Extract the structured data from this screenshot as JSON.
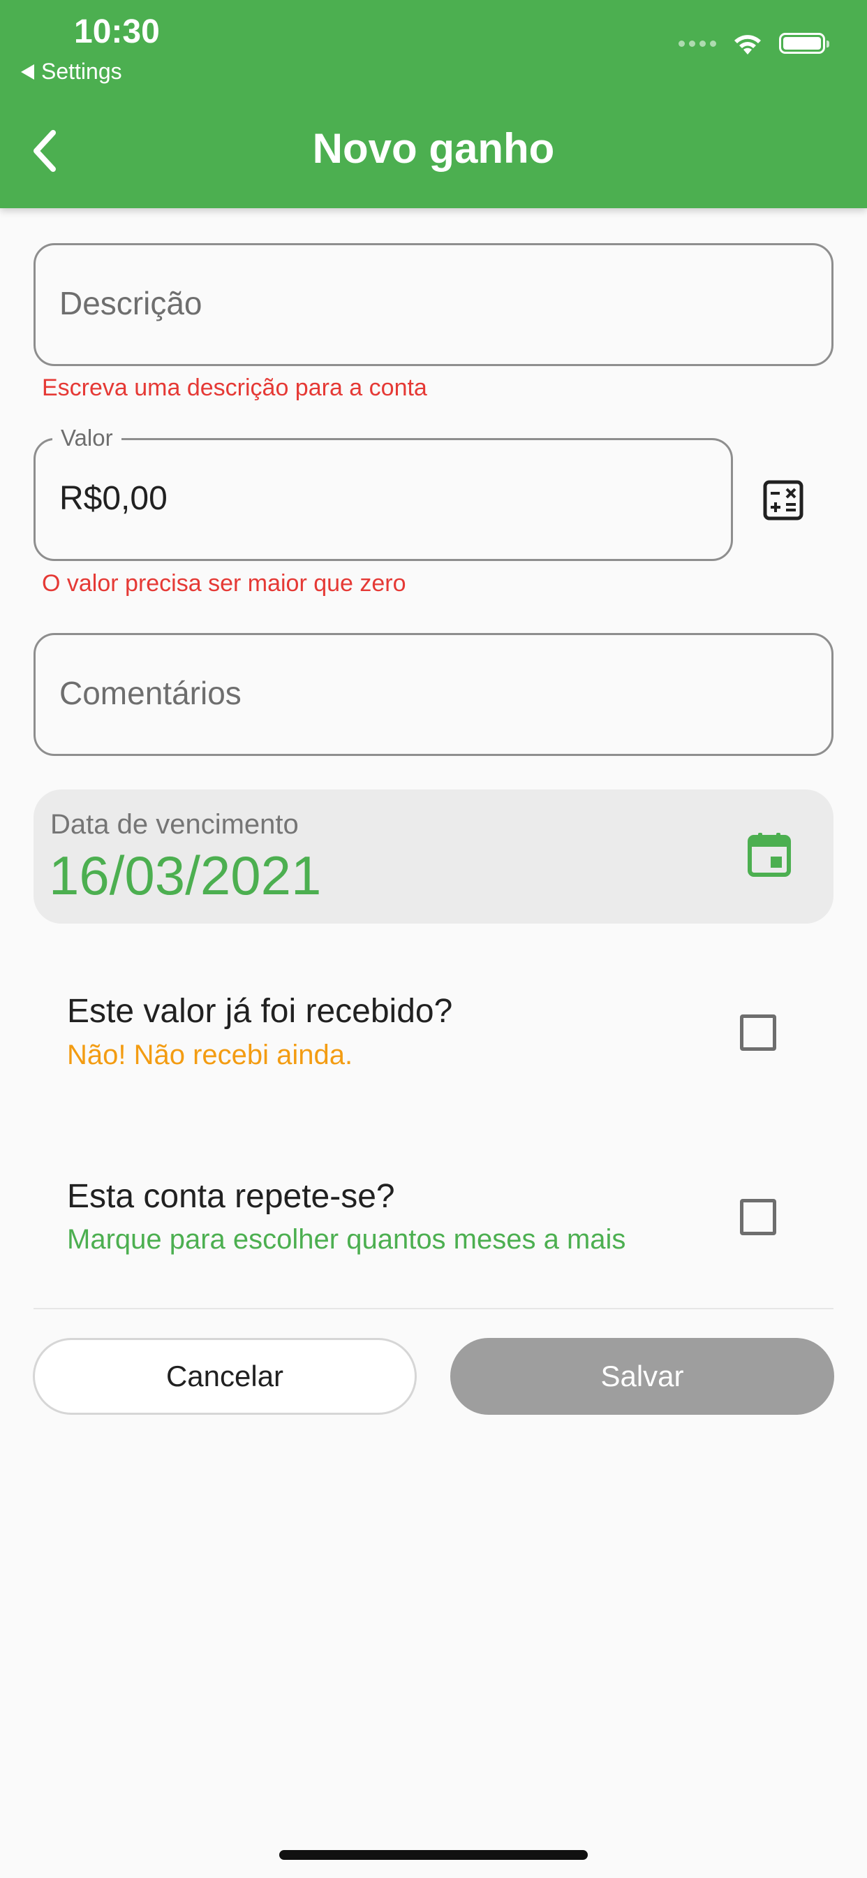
{
  "status_bar": {
    "time": "10:30",
    "back_label": "Settings"
  },
  "app_bar": {
    "title": "Novo ganho"
  },
  "form": {
    "descricao": {
      "placeholder": "Descrição",
      "error": "Escreva uma descrição para a conta"
    },
    "valor": {
      "label": "Valor",
      "value": "R$0,00",
      "error": "O valor precisa ser maior que zero"
    },
    "comentarios": {
      "placeholder": "Comentários"
    },
    "data": {
      "label": "Data de vencimento",
      "value": "16/03/2021"
    },
    "recebido": {
      "title": "Este valor já foi recebido?",
      "subtitle": "Não! Não recebi ainda.",
      "checked": false
    },
    "repete": {
      "title": "Esta conta repete-se?",
      "subtitle": "Marque para escolher quantos meses a mais",
      "checked": false
    }
  },
  "buttons": {
    "cancel": "Cancelar",
    "save": "Salvar"
  },
  "colors": {
    "primary": "#4caf50",
    "error": "#e53935",
    "warning": "#f39c12",
    "disabled_button": "#9e9e9e"
  },
  "icons": {
    "back": "chevron-left-icon",
    "calculator": "calculator-icon",
    "calendar": "calendar-icon",
    "wifi": "wifi-icon",
    "battery": "battery-icon"
  }
}
